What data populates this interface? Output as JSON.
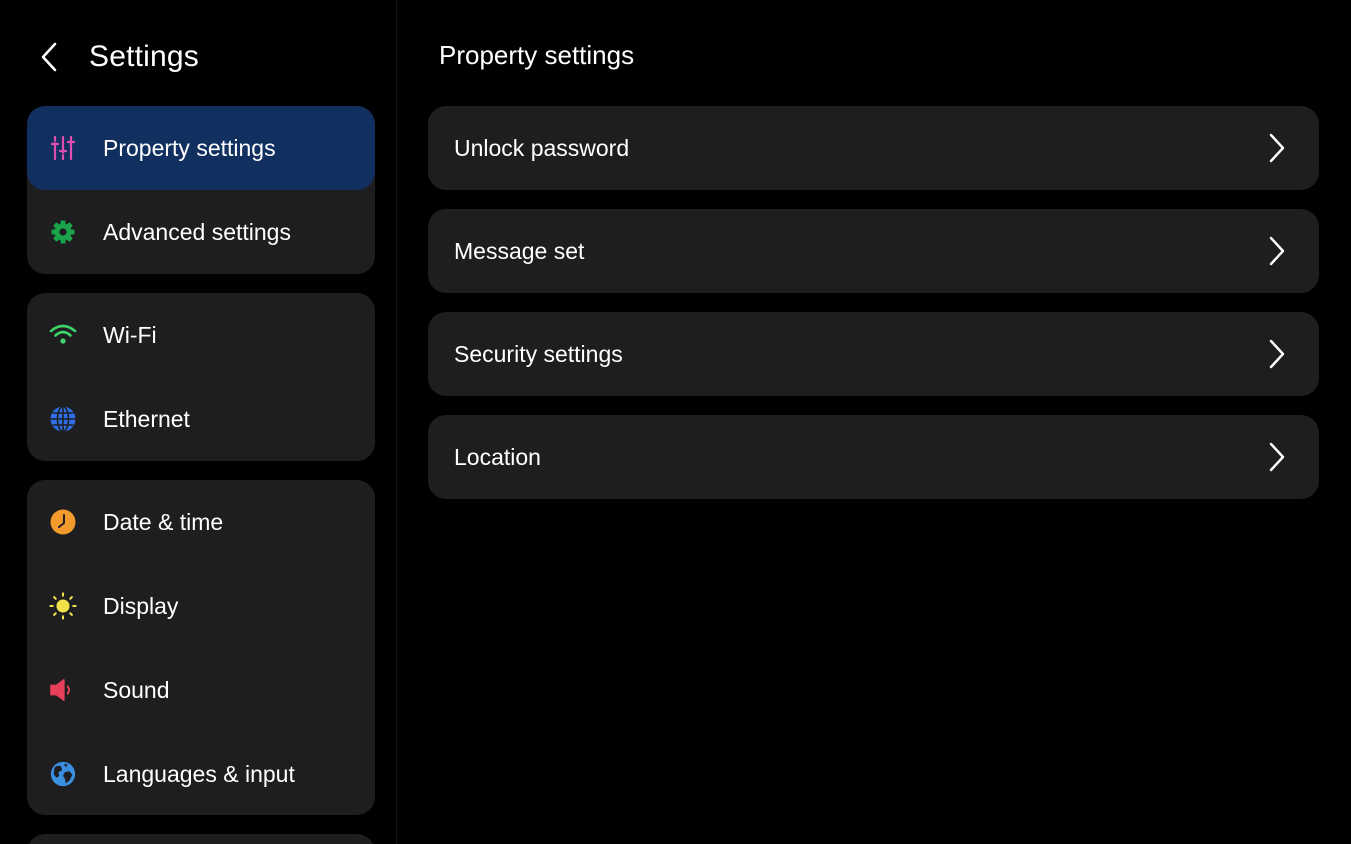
{
  "left": {
    "title": "Settings",
    "groups": [
      {
        "items": [
          {
            "label": "Property settings",
            "icon": "sliders-icon",
            "color": "#e04fb0",
            "active": true
          },
          {
            "label": "Advanced settings",
            "icon": "gear-icon",
            "color": "#1aa34a"
          }
        ]
      },
      {
        "items": [
          {
            "label": "Wi-Fi",
            "icon": "wifi-icon",
            "color": "#3fd46a"
          },
          {
            "label": "Ethernet",
            "icon": "globe-icon",
            "color": "#2f6fe6"
          }
        ]
      },
      {
        "items": [
          {
            "label": "Date & time",
            "icon": "clock-icon",
            "color": "#f39a2c"
          },
          {
            "label": "Display",
            "icon": "sun-icon",
            "color": "#f2e24a"
          },
          {
            "label": "Sound",
            "icon": "speaker-icon",
            "color": "#e8405a"
          },
          {
            "label": "Languages & input",
            "icon": "earth-icon",
            "color": "#3a8fe0"
          }
        ]
      }
    ]
  },
  "right": {
    "title": "Property settings",
    "rows": [
      {
        "label": "Unlock password"
      },
      {
        "label": "Message set"
      },
      {
        "label": "Security settings"
      },
      {
        "label": "Location"
      }
    ]
  },
  "colors": {
    "background": "#000000",
    "card": "#1e1e20",
    "active": "#12305f"
  }
}
